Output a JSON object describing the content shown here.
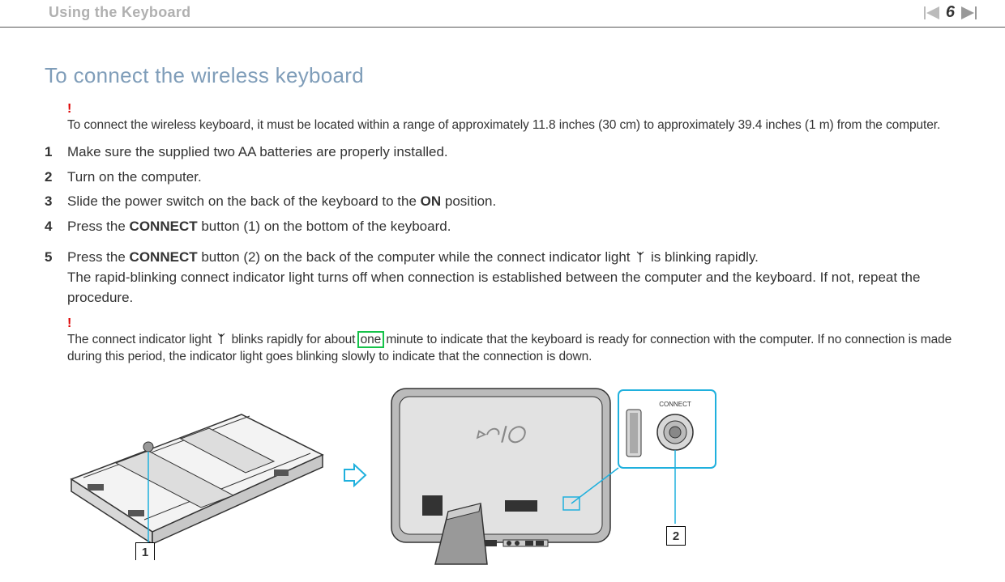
{
  "header": {
    "breadcrumb": "Using the Keyboard",
    "page_number": "6"
  },
  "section": {
    "title": "To connect the wireless keyboard",
    "note1": {
      "marker": "!",
      "text": "To connect the wireless keyboard, it must be located within a range of approximately 11.8 inches (30 cm) to approximately 39.4 inches (1 m) from the computer."
    },
    "steps": {
      "s1": {
        "num": "1",
        "text": "Make sure the supplied two AA batteries are properly installed."
      },
      "s2": {
        "num": "2",
        "text": "Turn on the computer."
      },
      "s3": {
        "num": "3",
        "pre": "Slide the power switch on the back of the keyboard to the ",
        "bold": "ON",
        "post": " position."
      },
      "s4": {
        "num": "4",
        "pre": "Press the ",
        "bold": "CONNECT",
        "post": " button (1) on the bottom of the keyboard."
      },
      "s5": {
        "num": "5",
        "line1_pre": "Press the ",
        "line1_bold": "CONNECT",
        "line1_mid": " button (2) on the back of the computer while the connect indicator light ",
        "line1_post": " is blinking rapidly.",
        "line2": "The rapid-blinking connect indicator light turns off when connection is established between the computer and the keyboard. If not, repeat the procedure."
      }
    },
    "note2": {
      "marker": "!",
      "pre": "The connect indicator light ",
      "mid1": " blinks rapidly for about ",
      "highlight": "one",
      "mid2": " minute to indicate that the keyboard is ready for connection with the computer. If no connection is made during this period, the indicator light goes blinking slowly to indicate that the connection is down."
    }
  },
  "figure": {
    "callout1": "1",
    "callout2": "2",
    "connect_label": "CONNECT"
  }
}
